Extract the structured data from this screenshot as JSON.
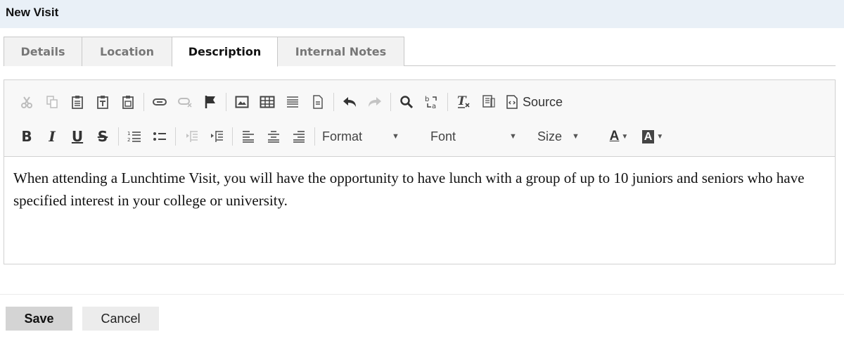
{
  "header": {
    "title": "New Visit"
  },
  "tabs": [
    {
      "label": "Details",
      "active": false
    },
    {
      "label": "Location",
      "active": false
    },
    {
      "label": "Description",
      "active": true
    },
    {
      "label": "Internal Notes",
      "active": false
    }
  ],
  "toolbar": {
    "row1_icons": [
      "cut-icon",
      "copy-icon",
      "paste-icon",
      "paste-text-icon",
      "paste-word-icon",
      "link-icon",
      "unlink-icon",
      "anchor-icon",
      "image-icon",
      "table-icon",
      "horizontal-line-icon",
      "page-break-icon",
      "undo-icon",
      "redo-icon",
      "find-icon",
      "replace-icon",
      "remove-format-icon",
      "templates-icon",
      "source-icon"
    ],
    "source_label": "Source",
    "format_label": "Format",
    "font_label": "Font",
    "size_label": "Size",
    "bold_label": "B",
    "italic_label": "I",
    "underline_label": "U",
    "strike_label": "S",
    "text_color_label": "A",
    "bg_color_label": "A"
  },
  "editor": {
    "content": "When attending a Lunchtime Visit, you will have the opportunity to have lunch with a group of up to 10 juniors and seniors who have specified interest in your college or university."
  },
  "actions": {
    "save_label": "Save",
    "cancel_label": "Cancel"
  },
  "colors": {
    "header_bg": "#e9f0f7",
    "toolbar_bg": "#f8f8f8",
    "save_bg": "#d4d4d4",
    "cancel_bg": "#ececec"
  }
}
